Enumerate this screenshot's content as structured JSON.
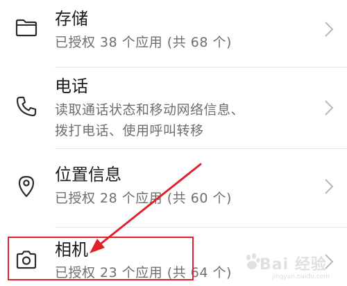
{
  "permissions": [
    {
      "icon": "folder-icon",
      "title": "存储",
      "subtitle": "已授权 38 个应用 (共 68 个)"
    },
    {
      "icon": "phone-icon",
      "title": "电话",
      "subtitle": "读取通话状态和移动网络信息、拨打电话、使用呼叫转移"
    },
    {
      "icon": "location-pin-icon",
      "title": "位置信息",
      "subtitle": "已授权 28 个应用 (共 60 个)"
    },
    {
      "icon": "camera-icon",
      "title": "相机",
      "subtitle": "已授权 23 个应用 (共 64 个)"
    }
  ],
  "annotation": {
    "color": "#e0202a",
    "target": "相机"
  },
  "watermark": {
    "text": "Bai 经验",
    "url": "jingyan.baidu.com"
  }
}
